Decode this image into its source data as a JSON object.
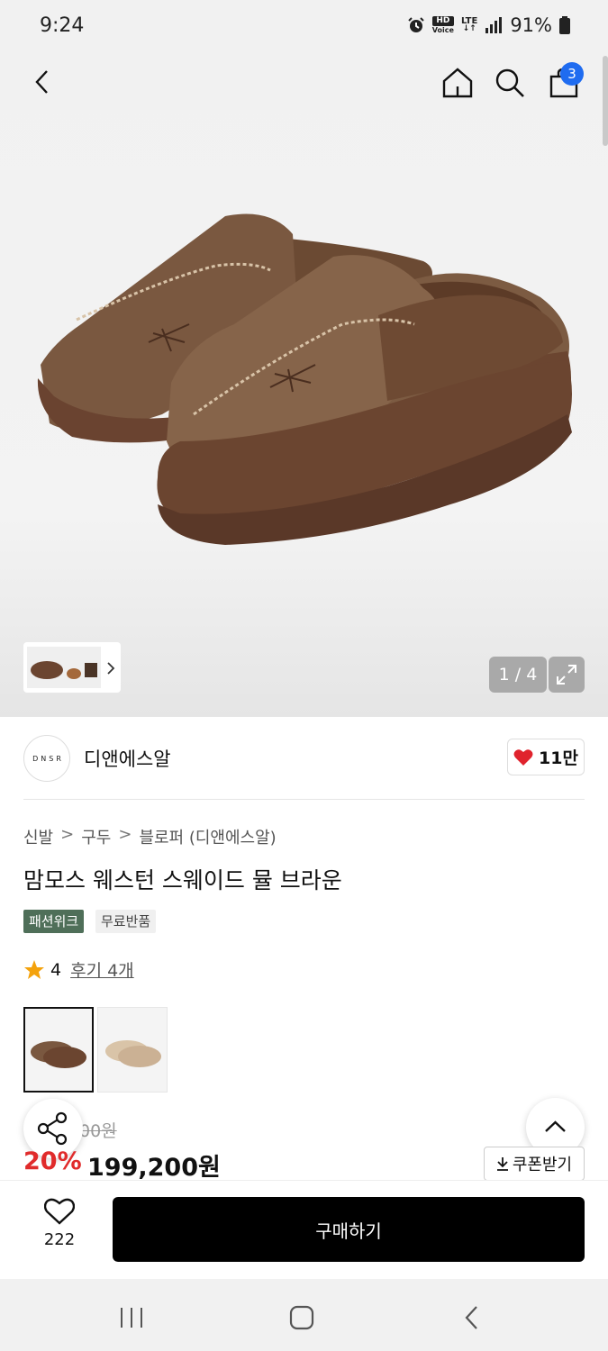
{
  "status": {
    "time": "9:24",
    "hd": "HD",
    "voice": "Voice",
    "lte": "LTE",
    "battery": "91%"
  },
  "header": {
    "cart_count": "3"
  },
  "gallery": {
    "page": "1 / 4"
  },
  "brand": {
    "logo": "DNSR",
    "name": "디앤에스알",
    "likes": "11만"
  },
  "breadcrumb": [
    "신발",
    "구두",
    "블로퍼 (디앤에스알)"
  ],
  "product": {
    "title": "맘모스 웨스턴 스웨이드 뮬 브라운",
    "tags": [
      "패션위크",
      "무료반품"
    ]
  },
  "rating": {
    "score": "4",
    "reviews": "후기 4개"
  },
  "price": {
    "original": "00원",
    "discount": "20%",
    "sale": "199,200원",
    "coupon": "쿠폰받기"
  },
  "bottom": {
    "wish_count": "222",
    "buy": "구매하기"
  },
  "colors": {
    "accent": "#1f6cf0",
    "discount": "#e02b2b",
    "tag": "#4f6f59",
    "star": "#f4a20c"
  }
}
